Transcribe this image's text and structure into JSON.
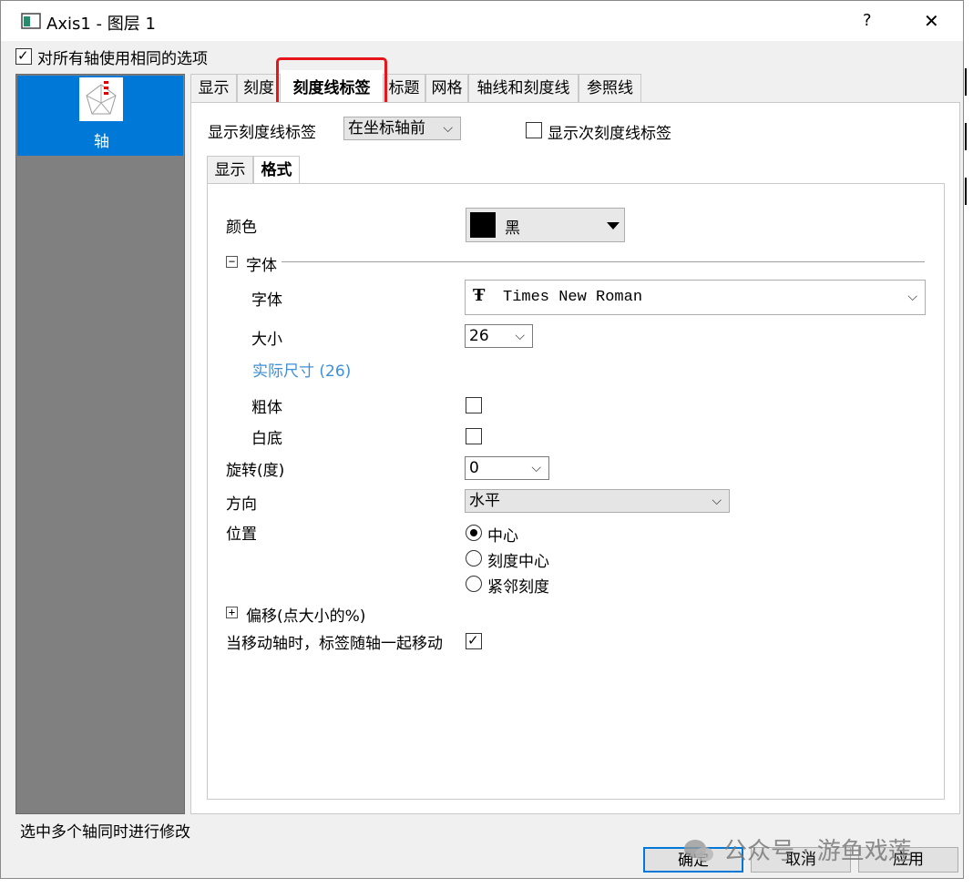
{
  "window": {
    "title": "Axis1 - 图层 1",
    "help_glyph": "?",
    "close_glyph": "✕"
  },
  "global_option": {
    "label": "对所有轴使用相同的选项",
    "checked": true
  },
  "sidebar": {
    "items": [
      {
        "label": "轴",
        "icon": "axis-pentagon-icon",
        "selected": true
      }
    ]
  },
  "tabs": [
    {
      "label": "显示"
    },
    {
      "label": "刻度"
    },
    {
      "label": "刻度线标签",
      "active": true
    },
    {
      "label": "标题"
    },
    {
      "label": "网格"
    },
    {
      "label": "轴线和刻度线"
    },
    {
      "label": "参照线"
    }
  ],
  "show_ticklabel": {
    "label": "显示刻度线标签",
    "value": "在坐标轴前"
  },
  "show_minor": {
    "label": "显示次刻度线标签",
    "checked": false
  },
  "subtabs": [
    {
      "label": "显示"
    },
    {
      "label": "格式",
      "active": true
    }
  ],
  "format": {
    "color": {
      "label": "颜色",
      "value": "黑",
      "swatch": "#000000"
    },
    "font_group": {
      "label": "字体",
      "toggle": "−"
    },
    "font": {
      "label": "字体",
      "value": "Times New Roman",
      "icon": "truetype-font-icon"
    },
    "size": {
      "label": "大小",
      "value": "26"
    },
    "actual_size": "实际尺寸 (26)",
    "bold": {
      "label": "粗体",
      "checked": false
    },
    "white_bg": {
      "label": "白底",
      "checked": false
    },
    "rotation": {
      "label": "旋转(度)",
      "value": "0"
    },
    "direction": {
      "label": "方向",
      "value": "水平"
    },
    "position": {
      "label": "位置",
      "options": [
        {
          "label": "中心",
          "selected": true
        },
        {
          "label": "刻度中心",
          "selected": false
        },
        {
          "label": "紧邻刻度",
          "selected": false
        }
      ]
    },
    "offset": {
      "label": "偏移(点大小的%)",
      "toggle": "+"
    },
    "move_with_axis": {
      "label": "当移动轴时，标签随轴一起移动",
      "checked": true
    }
  },
  "status_text": "选中多个轴同时进行修改",
  "buttons": {
    "ok": "确定",
    "cancel": "取消",
    "apply": "应用"
  },
  "watermark": "公众号 · 游鱼戏莲",
  "colors": {
    "selection": "#0078d7",
    "highlight_box": "#e8141b",
    "link": "#3c8fd8"
  }
}
